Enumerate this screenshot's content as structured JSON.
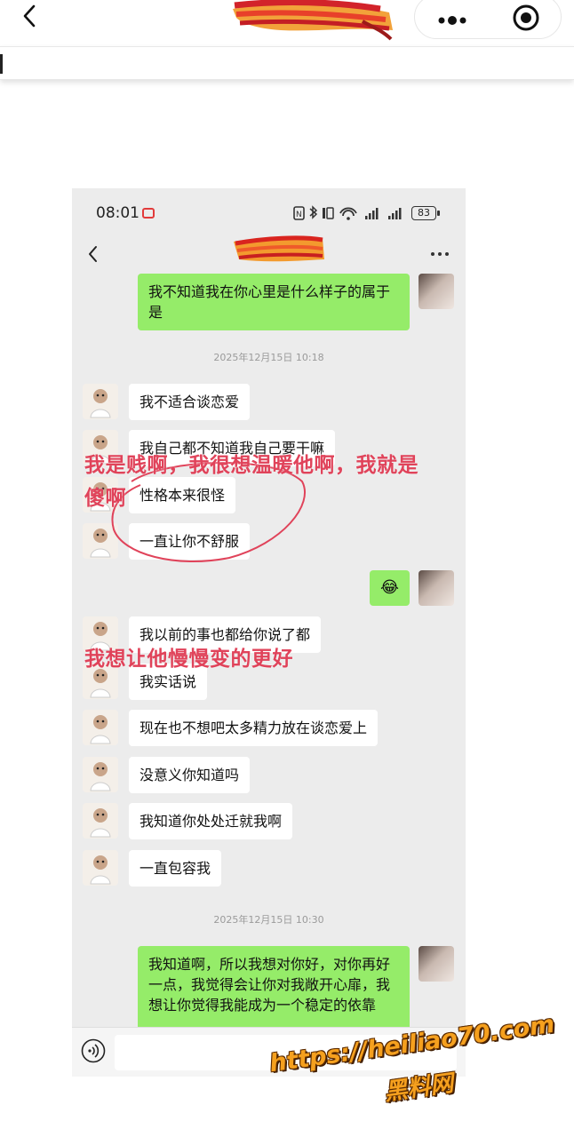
{
  "phone": {
    "time": "08:01",
    "battery": "83"
  },
  "messages": {
    "m1": "我不知道我在你心里是什么样子的属于是",
    "ts1": "2025年12月15日 10:18",
    "m2": "我不适合谈恋爱",
    "m3": "我自己都不知道我自己要干嘛",
    "m4": "性格本来很怪",
    "m5": "一直让你不舒服",
    "m6": "😂",
    "m7": "我以前的事也都给你说了都",
    "m8": "我实话说",
    "m9": "现在也不想吧太多精力放在谈恋爱上",
    "m10": "没意义你知道吗",
    "m11": "我知道你处处迁就我啊",
    "m12": "一直包容我",
    "ts2": "2025年12月15日 10:30",
    "m13": "我知道啊，所以我想对你好，对你再好一点，我觉得会让你对我敞开心扉，我想让你觉得我能成为一个稳定的依靠"
  },
  "annotations": {
    "line1": "我是贱啊，我很想温暖他啊，我就是",
    "line2": "傻啊",
    "line3": "我想让他慢慢变的更好"
  },
  "watermark": {
    "url": "https://heiliao70.com",
    "name": "黑料网"
  },
  "colors": {
    "bubble_green": "#95ec69",
    "annotation_red": "#e0435a",
    "watermark_orange": "#f5a01e"
  }
}
